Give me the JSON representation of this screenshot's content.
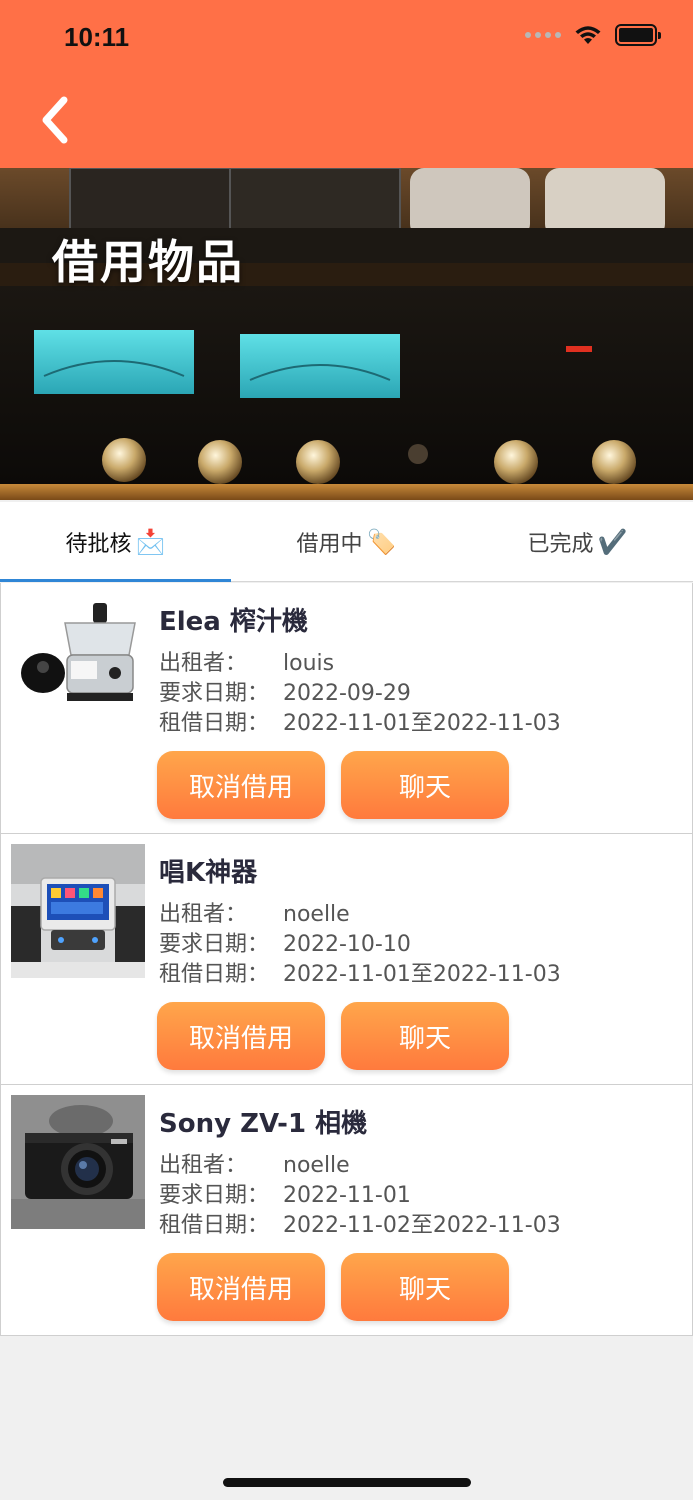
{
  "status_bar": {
    "time": "10:11"
  },
  "header": {
    "title": "借用物品"
  },
  "tabs": [
    {
      "label": "待批核",
      "icon": "📩",
      "icon_name": "envelope-icon",
      "active": true
    },
    {
      "label": "借用中",
      "icon": "🏷️",
      "icon_name": "tag-icon",
      "active": false
    },
    {
      "label": "已完成",
      "icon": "✔️",
      "icon_name": "check-icon",
      "active": false
    }
  ],
  "labels": {
    "owner": "出租者：",
    "request_date": "要求日期：",
    "rent_date": "租借日期：",
    "cancel": "取消借用",
    "chat": "聊天"
  },
  "items": [
    {
      "name": "Elea 榨汁機",
      "owner": "louis",
      "request_date": "2022-09-29",
      "rent_period": "2022-11-01至2022-11-03",
      "thumb": "juicer"
    },
    {
      "name": "唱K神器",
      "owner": "noelle",
      "request_date": "2022-10-10",
      "rent_period": "2022-11-01至2022-11-03",
      "thumb": "karaoke"
    },
    {
      "name": "Sony ZV-1 相機",
      "owner": "noelle",
      "request_date": "2022-11-01",
      "rent_period": "2022-11-02至2022-11-03",
      "thumb": "camera"
    }
  ],
  "colors": {
    "accent": "#ff7047",
    "button_top": "#ffa64b",
    "button_bottom": "#ff7a3d",
    "tab_indicator": "#2f86d6"
  }
}
